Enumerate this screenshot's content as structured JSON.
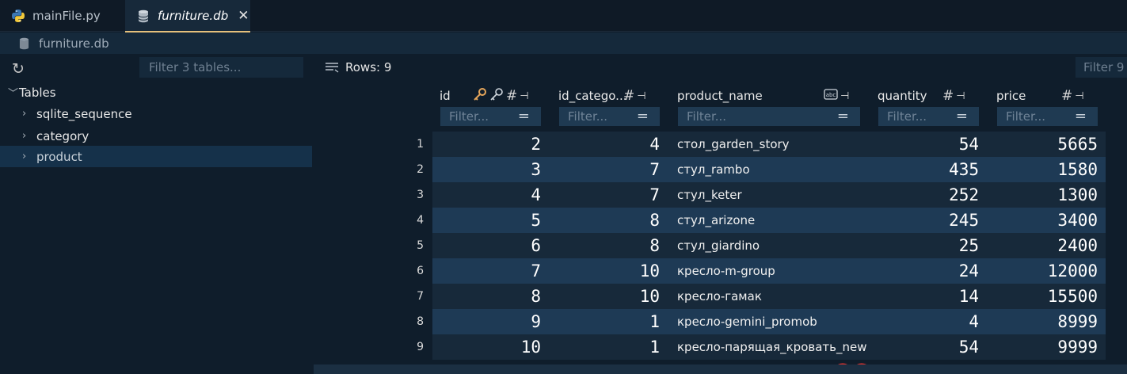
{
  "tabs": [
    {
      "label": "mainFile.py",
      "icon": "python-icon"
    },
    {
      "label": "furniture.db",
      "icon": "database-icon",
      "active": true
    }
  ],
  "breadcrumb": {
    "label": "furniture.db"
  },
  "sidebar": {
    "filter_placeholder": "Filter 3 tables...",
    "tree": {
      "root_label": "Tables",
      "items": [
        "sqlite_sequence",
        "category",
        "product"
      ],
      "selected": "product"
    }
  },
  "grid": {
    "rows_label": "Rows: 9",
    "filter_placeholder": "Filter 9",
    "column_filter_placeholder": "Filter...",
    "columns": [
      {
        "name": "id",
        "type": "number",
        "primary_key": true
      },
      {
        "name": "id_catego...",
        "type": "number"
      },
      {
        "name": "product_name",
        "type": "text"
      },
      {
        "name": "quantity",
        "type": "number"
      },
      {
        "name": "price",
        "type": "number"
      }
    ],
    "rows": [
      {
        "n": "1",
        "id": "2",
        "id_category": "4",
        "product_name": "стол_garden_story",
        "quantity": "54",
        "price": "5665"
      },
      {
        "n": "2",
        "id": "3",
        "id_category": "7",
        "product_name": "стул_rambo",
        "quantity": "435",
        "price": "1580"
      },
      {
        "n": "3",
        "id": "4",
        "id_category": "7",
        "product_name": "стул_keter",
        "quantity": "252",
        "price": "1300"
      },
      {
        "n": "4",
        "id": "5",
        "id_category": "8",
        "product_name": "стул_arizone",
        "quantity": "245",
        "price": "3400"
      },
      {
        "n": "5",
        "id": "6",
        "id_category": "8",
        "product_name": "стул_giardino",
        "quantity": "25",
        "price": "2400"
      },
      {
        "n": "6",
        "id": "7",
        "id_category": "10",
        "product_name": "кресло-m-group",
        "quantity": "24",
        "price": "12000"
      },
      {
        "n": "7",
        "id": "8",
        "id_category": "10",
        "product_name": "кресло-гамак",
        "quantity": "14",
        "price": "15500"
      },
      {
        "n": "8",
        "id": "9",
        "id_category": "1",
        "product_name": "кресло-gemini_promob",
        "quantity": "4",
        "price": "8999"
      },
      {
        "n": "9",
        "id": "10",
        "id_category": "1",
        "product_name": "кресло-парящая_кровать_new",
        "quantity": "54",
        "price": "9999"
      }
    ]
  },
  "colors": {
    "accent_tab_underline": "#e5c07b",
    "key_icon": "#e5a55a",
    "spell_underline": "#e0342f"
  }
}
